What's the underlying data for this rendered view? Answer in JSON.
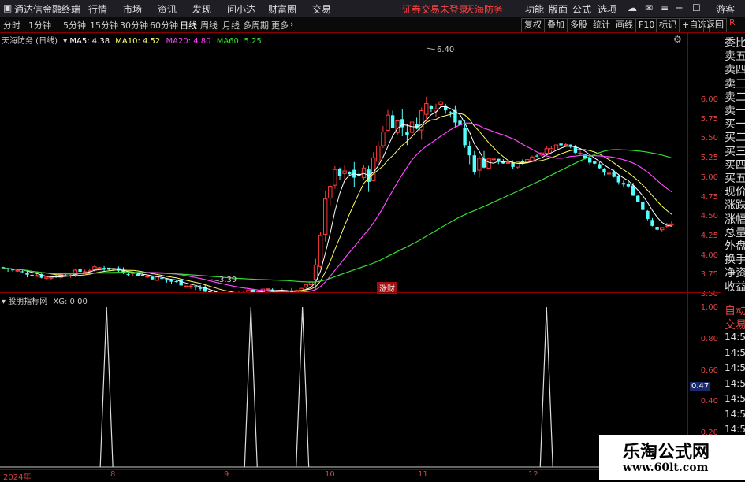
{
  "app": {
    "title": "通达信金融终端"
  },
  "menu": [
    "行情",
    "市场",
    "资讯",
    "发现",
    "问小达",
    "财富圈",
    "交易"
  ],
  "notice": {
    "text": "证券交易未登录",
    "stock": "天海防务"
  },
  "top_right": [
    "功能",
    "版面",
    "公式",
    "选项"
  ],
  "user": "游客",
  "periods": [
    "分时",
    "1分钟",
    "5分钟",
    "15分钟",
    "30分钟",
    "60分钟",
    "日线",
    "周线",
    "月线",
    "多周期",
    "更多"
  ],
  "active_period": "日线",
  "toolbar_right": [
    "复权",
    "叠加",
    "多股",
    "统计",
    "画线",
    "F10",
    "标记",
    "+自选",
    "返回"
  ],
  "main_chart": {
    "stock_label": "天海防务 (日线)",
    "ma": [
      {
        "name": "MA5",
        "value": "4.38",
        "color": "#ffffff"
      },
      {
        "name": "MA10",
        "value": "4.52",
        "color": "#ffff66"
      },
      {
        "name": "MA20",
        "value": "4.80",
        "color": "#ff44ff"
      },
      {
        "name": "MA60",
        "value": "5.25",
        "color": "#33dd33"
      }
    ],
    "high_marker": "6.40",
    "low_marker": "3.39",
    "badge": "涨财",
    "yticks": [
      "6.00",
      "5.75",
      "5.50",
      "5.25",
      "5.00",
      "4.75",
      "4.50",
      "4.25",
      "4.00",
      "3.75",
      "3.50"
    ]
  },
  "indicator": {
    "label": "股朋指标网",
    "xg": "XG: 0.00",
    "yticks": [
      "1.00",
      "0.80",
      "0.60",
      "0.40",
      "0.20"
    ],
    "cursor_value": "0.47",
    "spike_positions": [
      0.155,
      0.365,
      0.44,
      0.795
    ]
  },
  "xaxis": [
    "2024年",
    "8",
    "9",
    "10",
    "11",
    "12"
  ],
  "right_panel": {
    "r_badge": "R",
    "items": [
      "委比",
      "卖五",
      "卖四",
      "卖三",
      "卖二",
      "卖一",
      "买一",
      "买二",
      "买三",
      "买四",
      "买五",
      "现价",
      "涨跌",
      "涨幅",
      "总量",
      "外盘",
      "换手",
      "净资",
      "收益"
    ],
    "auto_trade": [
      "自动",
      "交易"
    ],
    "times": [
      "14:56",
      "14:56",
      "14:56",
      "14:56",
      "14:56",
      "14:56",
      "14:56",
      "14:56",
      "14:56"
    ]
  },
  "watermark": {
    "title": "乐淘公式网",
    "url": "www.60lt.com"
  }
}
